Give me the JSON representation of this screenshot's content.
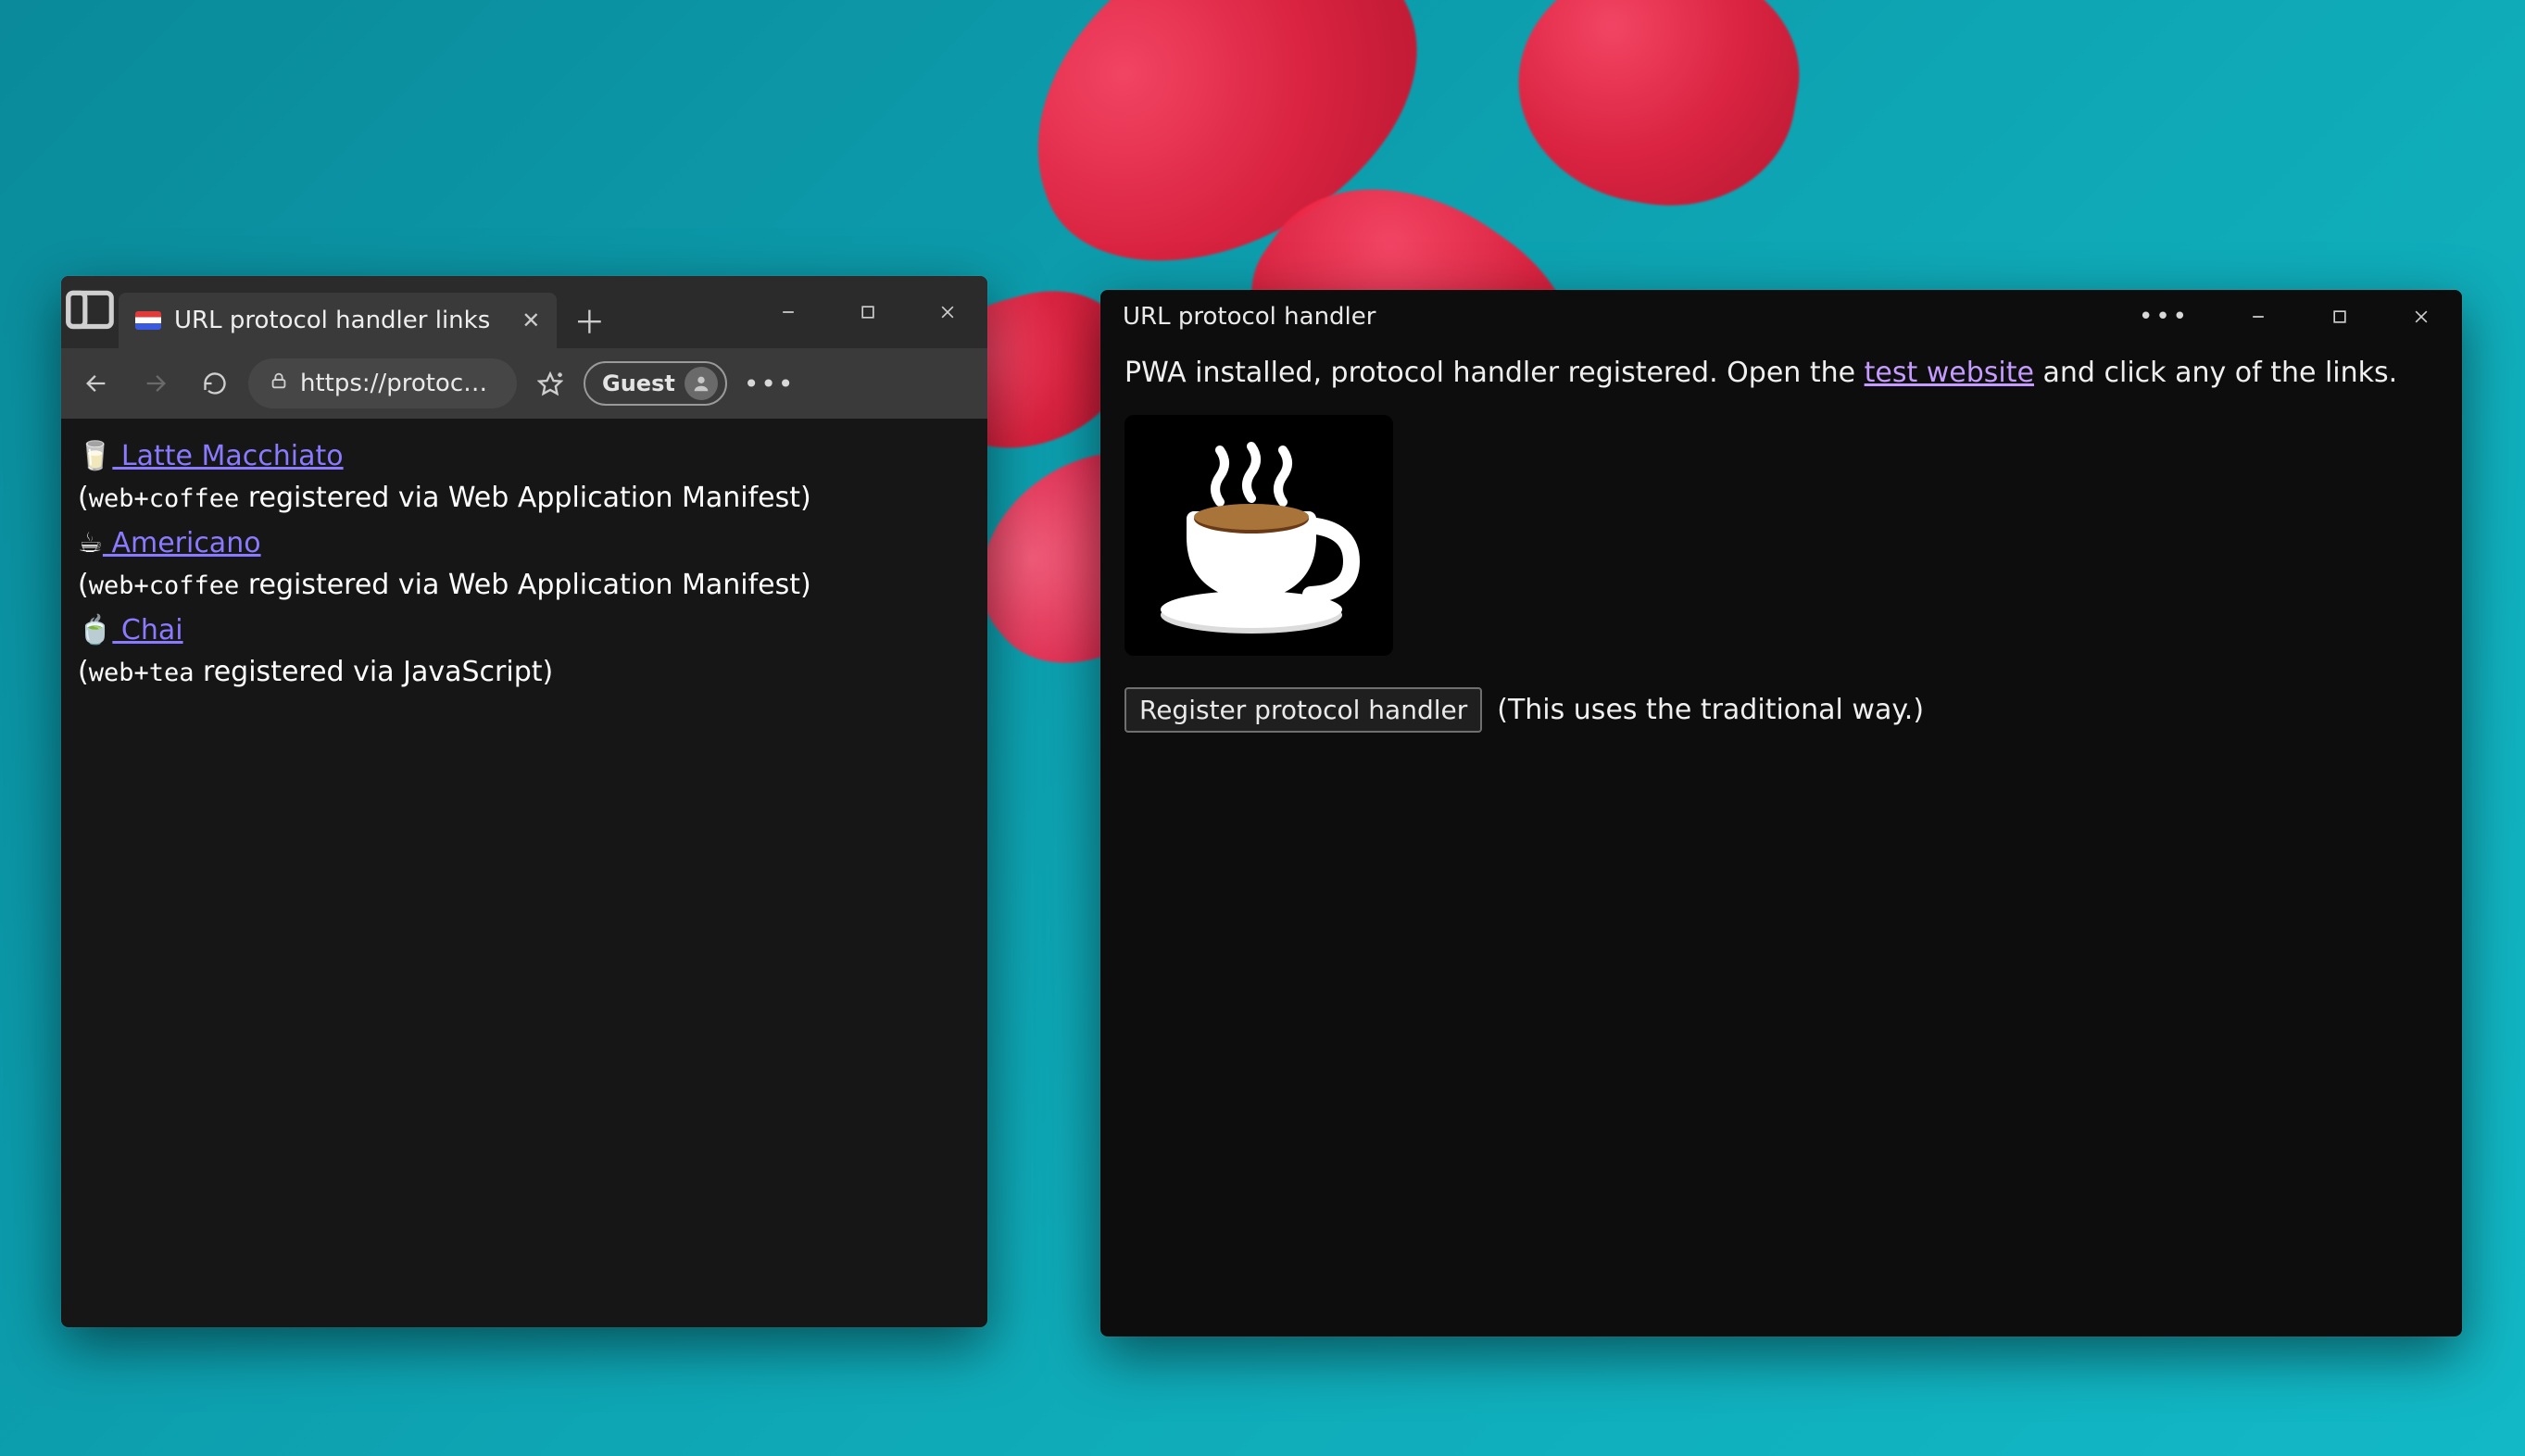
{
  "browser": {
    "tab_title": "URL protocol handler links",
    "url_display": "https://protoc…",
    "guest_label": "Guest",
    "links": [
      {
        "emoji": "🥛",
        "label": " Latte Macchiato",
        "detail_pre": "(",
        "proto": "web+coffee",
        "detail_post": " registered via Web Application Manifest)"
      },
      {
        "emoji": "☕",
        "label": " Americano",
        "detail_pre": "(",
        "proto": "web+coffee",
        "detail_post": " registered via Web Application Manifest)"
      },
      {
        "emoji": "🍵",
        "label": " Chai",
        "detail_pre": "(",
        "proto": "web+tea",
        "detail_post": " registered via JavaScript)"
      }
    ]
  },
  "pwa": {
    "title": "URL protocol handler",
    "msg_pre": "PWA installed, protocol handler registered. Open the ",
    "msg_link": "test website",
    "msg_post": " and click any of the links.",
    "button": "Register protocol handler",
    "button_note": "(This uses the traditional way.)"
  }
}
